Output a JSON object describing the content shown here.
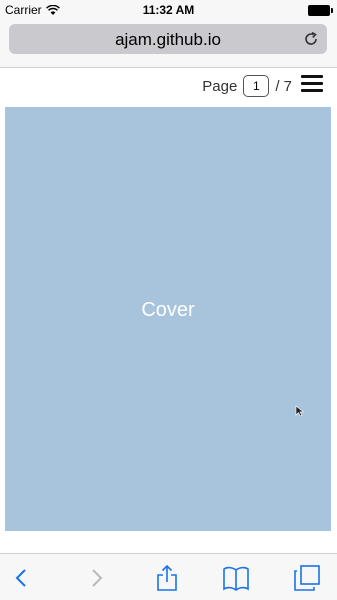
{
  "status_bar": {
    "carrier": "Carrier",
    "time": "11:32 AM"
  },
  "browser": {
    "url": "ajam.github.io"
  },
  "page_nav": {
    "label": "Page",
    "current_page": "1",
    "total": "/ 7"
  },
  "cover": {
    "title": "Cover",
    "background_color": "#a8c4dd"
  },
  "toolbar": {
    "icons": [
      "back-icon",
      "forward-icon",
      "share-icon",
      "bookmarks-icon",
      "tabs-icon"
    ],
    "accent_color": "#1a73e8"
  }
}
